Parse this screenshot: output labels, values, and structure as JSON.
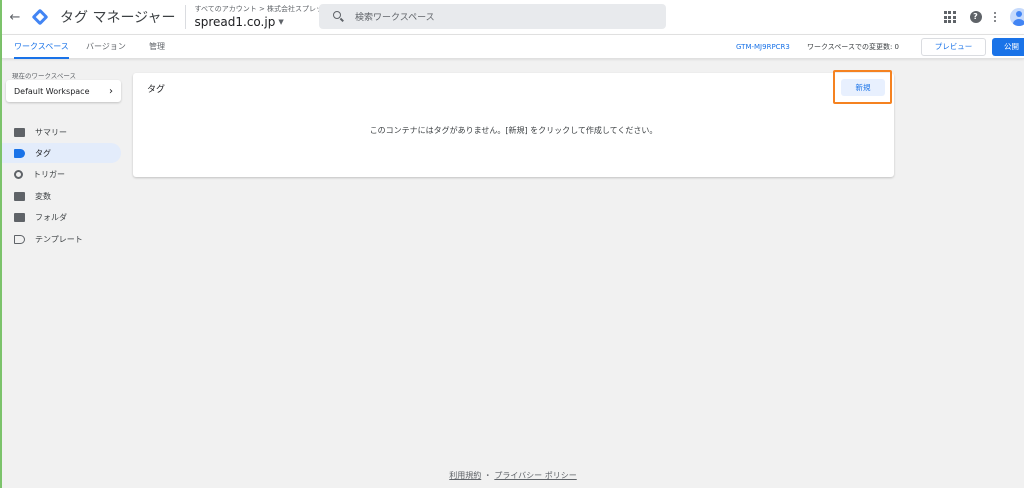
{
  "header": {
    "app_title": "タグ マネージャー",
    "account_breadcrumb": "すべてのアカウント > 株式会社スプレッドワン",
    "container_name": "spread1.co.jp",
    "search_placeholder": "検索ワークスペース"
  },
  "tabs": [
    {
      "label": "ワークスペース",
      "active": true
    },
    {
      "label": "バージョン",
      "active": false
    },
    {
      "label": "管理",
      "active": false
    }
  ],
  "toolbar": {
    "container_id": "GTM-MJ9RPCR3",
    "changes_text": "ワークスペースでの変更数: 0",
    "preview_label": "プレビュー",
    "publish_label": "公開"
  },
  "sidebar": {
    "workspace_label": "現在のワークスペース",
    "workspace_name": "Default Workspace",
    "items": [
      {
        "label": "サマリー",
        "icon": "summary-icon",
        "active": false
      },
      {
        "label": "タグ",
        "icon": "tag-icon",
        "active": true
      },
      {
        "label": "トリガー",
        "icon": "trigger-icon",
        "active": false
      },
      {
        "label": "変数",
        "icon": "variable-icon",
        "active": false
      },
      {
        "label": "フォルダ",
        "icon": "folder-icon",
        "active": false
      },
      {
        "label": "テンプレート",
        "icon": "template-icon",
        "active": false
      }
    ]
  },
  "main": {
    "card_title": "タグ",
    "new_button_label": "新規",
    "empty_message": "このコンテナにはタグがありません。[新規] をクリックして作成してください。"
  },
  "footer": {
    "terms_label": "利用規約",
    "separator": "・",
    "privacy_label": "プライバシー ポリシー"
  },
  "colors": {
    "accent": "#1a73e8",
    "highlight_outline": "#f58220",
    "active_nav_bg": "#e3ecfb"
  }
}
